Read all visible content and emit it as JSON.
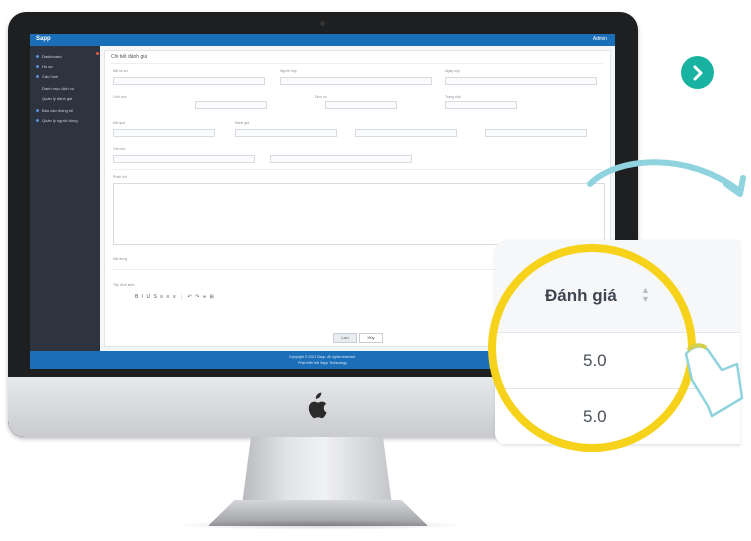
{
  "screen": {
    "app_logo": "Sapp",
    "user_name": "Admin",
    "sidebar_items": [
      "Dashboard",
      "Hồ sơ",
      "Cấu hình",
      "Danh mục dịch vụ",
      "Quản lý đánh giá",
      "Báo cáo thống kê",
      "Quản lý người dùng"
    ],
    "main_title": "Chi tiết đánh giá",
    "fields": [
      "Mã hồ sơ",
      "Người nộp",
      "Ngày nộp",
      "Lĩnh vực",
      "Dịch vụ",
      "Trạng thái",
      "Kết quả",
      "Đánh giá",
      "Ghi chú",
      "Phản hồi",
      "Nội dung",
      "Tệp đính kèm"
    ],
    "editor_toolbar": "B  I  U  S  ≡  ≡  ≡  ⋮  ↶  ↷  ∞  ⊞",
    "save_label": "Lưu",
    "cancel_label": "Hủy",
    "footer_line1": "Copyright © 2021 Sapp. All rights reserved.",
    "footer_line2": "Phát triển bởi Sapp Technology"
  },
  "zoom": {
    "column_header": "Đánh giá",
    "rows": [
      "5.0",
      "5.0"
    ]
  },
  "colors": {
    "accent_blue": "#1b6fb8",
    "teal": "#18b3a0",
    "highlight_yellow": "#f6d21a"
  },
  "icons": [
    "chevron-right-icon",
    "sort-icon",
    "apple-logo-icon",
    "pointer-arrow-icon"
  ]
}
